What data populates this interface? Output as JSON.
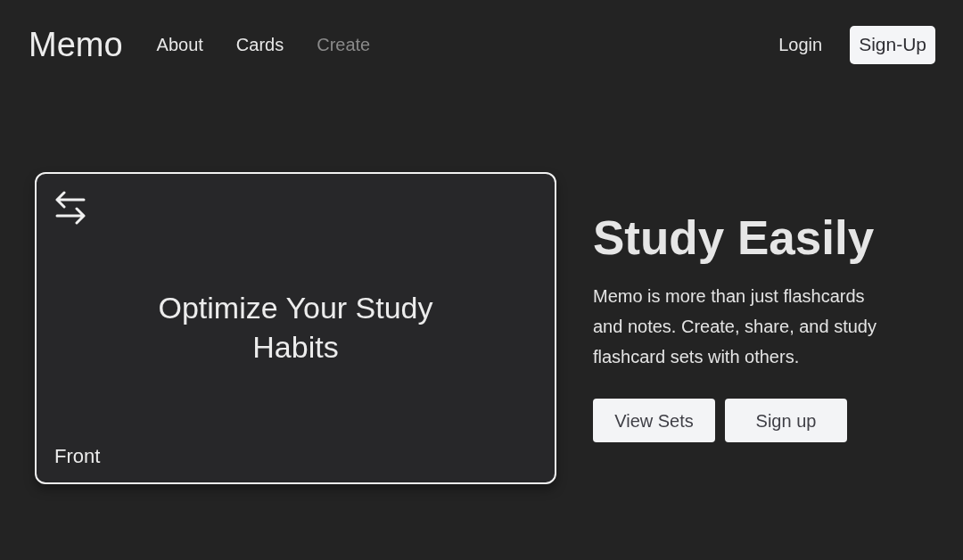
{
  "nav": {
    "brand": "Memo",
    "links": [
      {
        "label": "About",
        "disabled": false
      },
      {
        "label": "Cards",
        "disabled": false
      },
      {
        "label": "Create",
        "disabled": true
      }
    ],
    "login": "Login",
    "signup": "Sign-Up"
  },
  "card": {
    "text": "Optimize Your Study Habits",
    "side": "Front"
  },
  "hero": {
    "title": "Study Easily",
    "text": "Memo is more than just flashcards and notes. Create, share, and study flashcard sets with others.",
    "buttons": [
      "View Sets",
      "Sign up"
    ]
  }
}
